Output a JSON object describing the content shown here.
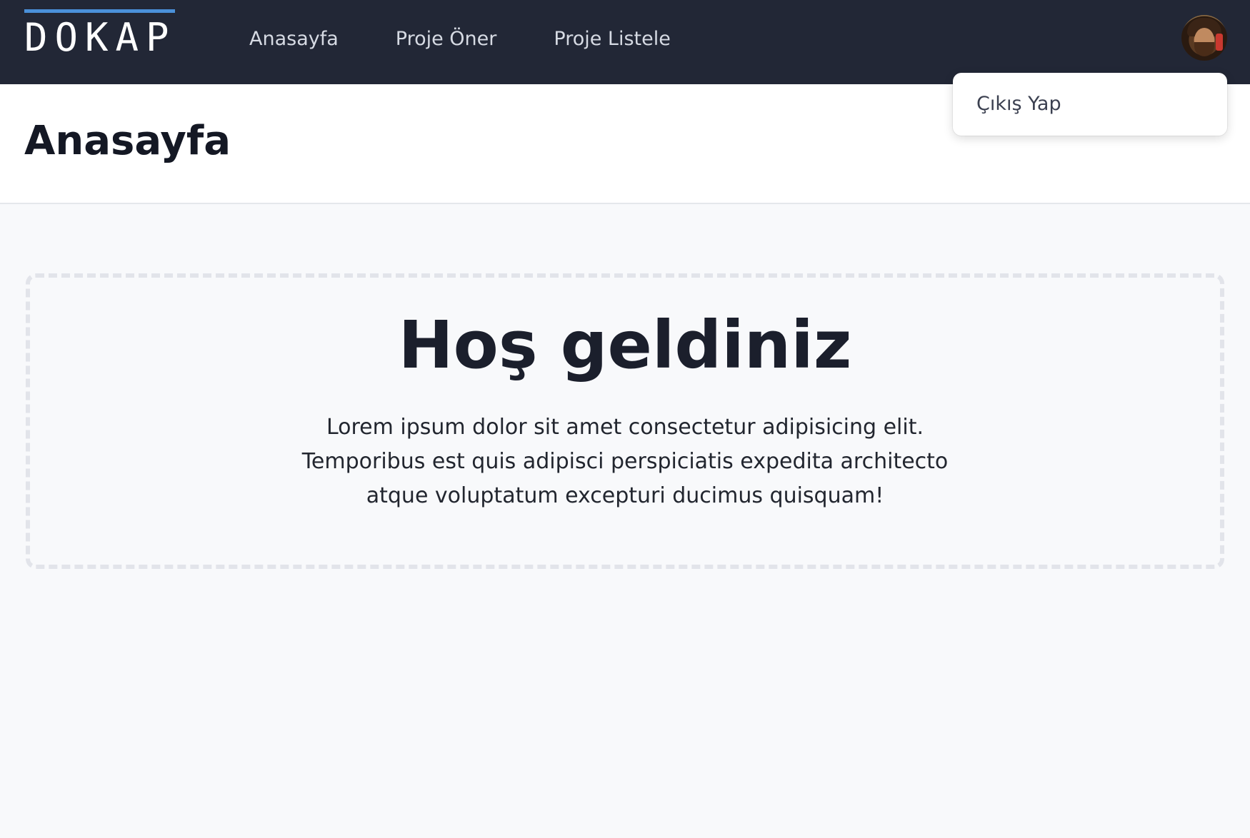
{
  "app": {
    "logo": "DOKAP",
    "accent_color": "#4a90d9",
    "topbar_color": "#222736"
  },
  "nav": {
    "items": [
      {
        "label": "Anasayfa"
      },
      {
        "label": "Proje Öner"
      },
      {
        "label": "Proje Listele"
      }
    ]
  },
  "user_menu": {
    "avatar_icon": "user-avatar",
    "items": [
      {
        "label": "Çıkış Yap"
      }
    ]
  },
  "header": {
    "title": "Anasayfa"
  },
  "main": {
    "welcome_title": "Hoş geldiniz",
    "welcome_text": "Lorem ipsum dolor sit amet consectetur adipisicing elit. Temporibus est quis adipisci perspiciatis expedita architecto atque voluptatum excepturi ducimus quisquam!"
  }
}
